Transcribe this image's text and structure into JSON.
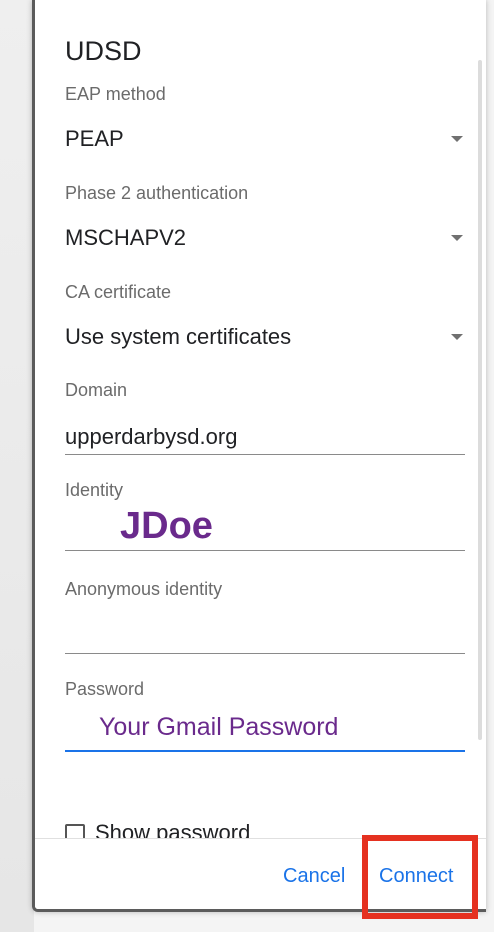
{
  "dialog": {
    "title": "UDSD"
  },
  "fields": {
    "eap_method": {
      "label": "EAP method",
      "value": "PEAP"
    },
    "phase2": {
      "label": "Phase 2 authentication",
      "value": "MSCHAPV2"
    },
    "ca_certificate": {
      "label": "CA certificate",
      "value": "Use system certificates"
    },
    "domain": {
      "label": "Domain",
      "value": "upperdarbysd.org"
    },
    "identity": {
      "label": "Identity",
      "value": "JDoe"
    },
    "anonymous_identity": {
      "label": "Anonymous identity",
      "value": ""
    },
    "password": {
      "label": "Password",
      "value": "Your Gmail Password"
    }
  },
  "show_password": {
    "label": "Show password",
    "checked": false
  },
  "buttons": {
    "cancel": "Cancel",
    "connect": "Connect"
  },
  "colors": {
    "accent": "#1a73e8",
    "annotation_text": "#6a2a8c",
    "highlight": "#e53120"
  },
  "icons": {
    "dropdown": "chevron-down-icon",
    "checkbox": "checkbox-unchecked-icon"
  }
}
